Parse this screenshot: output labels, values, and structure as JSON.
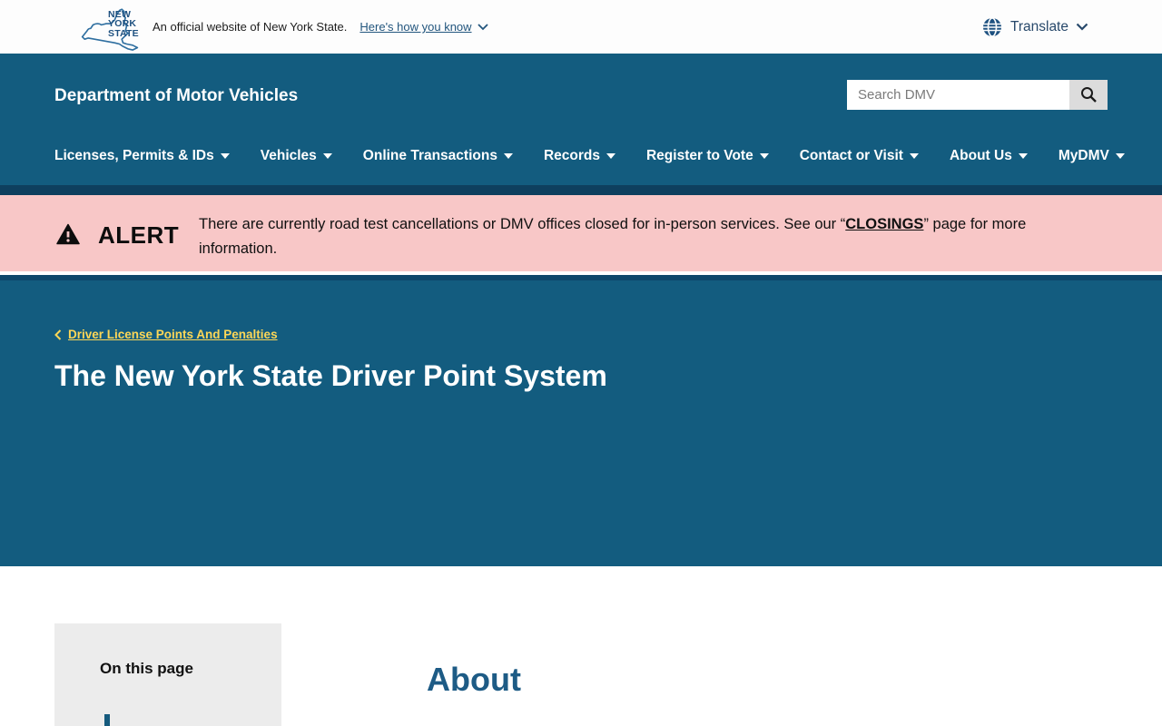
{
  "topbar": {
    "logo": {
      "line1": "NEW",
      "line2": "YORK",
      "line3": "STATE"
    },
    "official_text": "An official website of New York State.",
    "how_you_know_label": "Here's how you know",
    "translate_label": "Translate"
  },
  "header": {
    "agency_title": "Department of Motor Vehicles",
    "search_placeholder": "Search DMV"
  },
  "nav": {
    "items": [
      {
        "label": "Licenses, Permits & IDs"
      },
      {
        "label": "Vehicles"
      },
      {
        "label": "Online Transactions"
      },
      {
        "label": "Records"
      },
      {
        "label": "Register to Vote"
      },
      {
        "label": "Contact or Visit"
      },
      {
        "label": "About Us"
      },
      {
        "label": "MyDMV"
      }
    ]
  },
  "alert": {
    "label": "ALERT",
    "text_before": "There are currently road test cancellations or DMV offices closed for in-person services. See our “",
    "link_label": "CLOSINGS",
    "text_after": "” page for more information."
  },
  "hero": {
    "breadcrumb_label": "Driver License Points And Penalties",
    "page_title": "The New York State Driver Point System"
  },
  "content": {
    "on_this_page_label": "On this page",
    "section_heading": "About"
  },
  "colors": {
    "band_blue": "#135C7F",
    "dark_navy": "#0E3F5E",
    "alert_pink": "#F8C7C7",
    "breadcrumb_yellow": "#FDD757",
    "heading_blue": "#1D5B85",
    "sidebar_gray": "#ECECEC"
  }
}
